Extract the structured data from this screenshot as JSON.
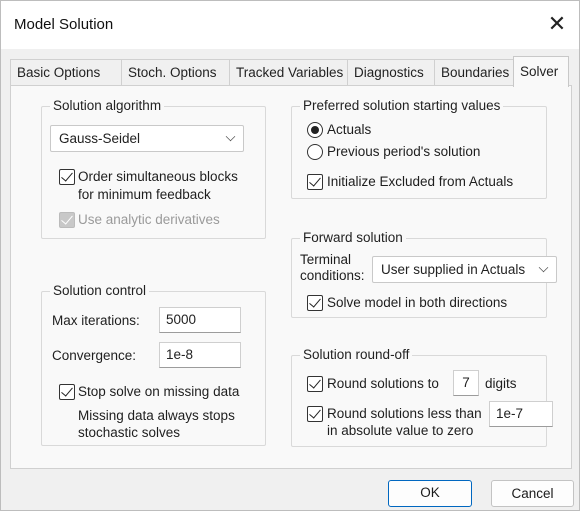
{
  "window": {
    "title": "Model Solution",
    "close_glyph": "✕"
  },
  "tabs": [
    {
      "label": "Basic Options"
    },
    {
      "label": "Stoch. Options"
    },
    {
      "label": "Tracked Variables"
    },
    {
      "label": "Diagnostics"
    },
    {
      "label": "Boundaries"
    },
    {
      "label": "Solver"
    }
  ],
  "active_tab": "Solver",
  "solution_algorithm": {
    "legend": "Solution algorithm",
    "selected": "Gauss-Seidel",
    "order_blocks": {
      "label_line1": "Order simultaneous blocks",
      "label_line2": "for  minimum feedback",
      "checked": true
    },
    "analytic_derivatives": {
      "label": "Use analytic derivatives",
      "checked": true,
      "disabled": true
    }
  },
  "solution_control": {
    "legend": "Solution control",
    "max_iterations": {
      "label": "Max iterations:",
      "value": "5000"
    },
    "convergence": {
      "label": "Convergence:",
      "value": "1e-8"
    },
    "stop_missing": {
      "label": "Stop solve on missing data",
      "checked": true
    },
    "note_line1": "Missing data always stops",
    "note_line2": "stochastic solves"
  },
  "starting_values": {
    "legend": "Preferred solution starting values",
    "actuals": {
      "label": "Actuals",
      "checked": true
    },
    "previous": {
      "label": "Previous period's solution",
      "checked": false
    },
    "init_excluded": {
      "label": "Initialize Excluded from Actuals",
      "checked": true
    }
  },
  "forward_solution": {
    "legend": "Forward solution",
    "terminal_label_line1": "Terminal",
    "terminal_label_line2": "conditions:",
    "terminal_selected": "User supplied in Actuals",
    "both_directions": {
      "label": "Solve model in both directions",
      "checked": true
    }
  },
  "roundoff": {
    "legend": "Solution round-off",
    "round_to": {
      "label": "Round solutions to",
      "value": "7",
      "suffix": "digits",
      "checked": true
    },
    "round_less": {
      "label_line1": "Round solutions less than",
      "label_line2": "in absolute value to zero",
      "value": "1e-7",
      "checked": true
    }
  },
  "buttons": {
    "ok": "OK",
    "cancel": "Cancel"
  },
  "colors": {
    "accent": "#0067c0",
    "panel": "#f9f9f9",
    "background": "#f0f0f0"
  }
}
